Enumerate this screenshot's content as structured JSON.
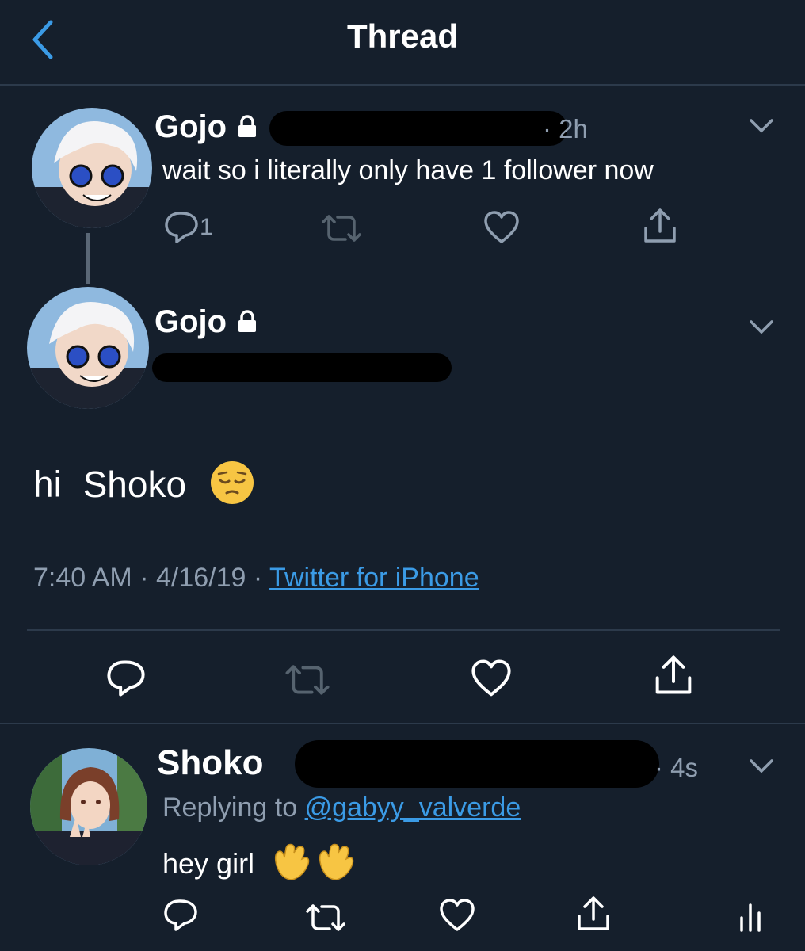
{
  "header": {
    "title": "Thread"
  },
  "tweet1": {
    "name": "Gojo",
    "time": "· 2h",
    "text": "wait so i literally only have 1 follower now",
    "reply_count": "1"
  },
  "tweet2": {
    "name": "Gojo",
    "handle_prefix": "@",
    "text_hi": "hi",
    "text_name": "Shoko",
    "emoji_name": "pensive-face",
    "time": "7:40 AM",
    "date": "4/16/19",
    "source": "Twitter for iPhone"
  },
  "tweet3": {
    "name": "Shoko",
    "time": "· 4s",
    "replying_prefix": "Replying to",
    "replying_handle": "@gabyy_valverde",
    "text": "hey girl",
    "emoji_name": "waving-hands"
  },
  "colors": {
    "background": "#151f2c",
    "muted": "#8f9eb0",
    "link": "#3b9be6",
    "divider": "#2c3a4b"
  }
}
